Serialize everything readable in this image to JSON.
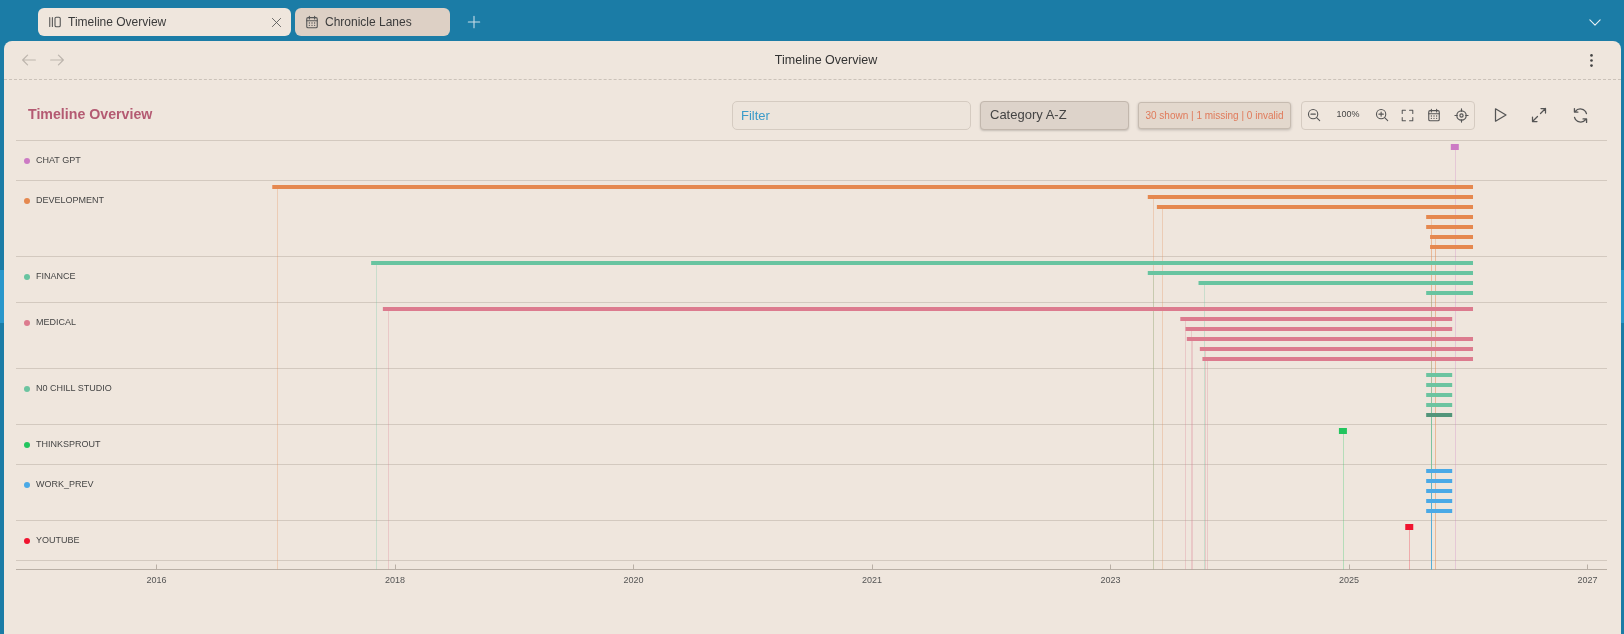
{
  "tabs": [
    {
      "label": "Timeline Overview",
      "kind": "overview",
      "selected": true
    },
    {
      "label": "Chronicle Lanes",
      "kind": "lanes",
      "selected": false
    }
  ],
  "nav": {
    "title": "Timeline Overview",
    "back": {
      "disabled": true
    },
    "forward": {
      "disabled": true
    }
  },
  "toolbar": {
    "title": "Timeline Overview",
    "filter": {
      "placeholder": "Filter"
    },
    "sort": {
      "value": "Category A-Z"
    },
    "summary": "30 shown | 1 missing | 0 invalid",
    "zoom_level": "100%"
  },
  "timeline": {
    "lanes": [
      {
        "name": "CHAT GPT",
        "color": "#cc7ac4",
        "bars": [
          {
            "kind": "point",
            "selected": false
          }
        ]
      },
      {
        "name": "DEVELOPMENT",
        "color": "#e5884f",
        "bars": [
          {
            "kind": "range",
            "selected": false
          },
          {
            "kind": "range",
            "selected": false
          },
          {
            "kind": "range",
            "selected": false
          },
          {
            "kind": "range",
            "selected": false
          },
          {
            "kind": "range",
            "selected": false
          },
          {
            "kind": "range",
            "selected": false
          },
          {
            "kind": "range",
            "selected": false
          }
        ]
      },
      {
        "name": "FINANCE",
        "color": "#68c4a0",
        "bars": [
          {
            "kind": "range",
            "selected": false
          },
          {
            "kind": "range",
            "selected": false
          },
          {
            "kind": "range",
            "selected": false
          },
          {
            "kind": "range",
            "selected": false
          }
        ]
      },
      {
        "name": "MEDICAL",
        "color": "#dc7b8e",
        "bars": [
          {
            "kind": "range",
            "selected": false
          },
          {
            "kind": "range",
            "selected": false
          },
          {
            "kind": "range",
            "selected": false
          },
          {
            "kind": "range",
            "selected": false
          },
          {
            "kind": "range",
            "selected": false
          },
          {
            "kind": "range",
            "selected": false
          }
        ]
      },
      {
        "name": "N0 CHILL STUDIO",
        "color": "#6cc4a0",
        "bars": [
          {
            "kind": "range",
            "selected": false
          },
          {
            "kind": "range",
            "selected": false
          },
          {
            "kind": "range",
            "selected": false
          },
          {
            "kind": "range",
            "selected": false
          },
          {
            "kind": "range",
            "selected": true
          }
        ]
      },
      {
        "name": "THINKSPROUT",
        "color": "#22c55e",
        "bars": [
          {
            "kind": "point",
            "selected": false
          }
        ]
      },
      {
        "name": "WORK_PREV",
        "color": "#4aa9e6",
        "bars": [
          {
            "kind": "range",
            "selected": false
          },
          {
            "kind": "range",
            "selected": false
          },
          {
            "kind": "range",
            "selected": false
          },
          {
            "kind": "range",
            "selected": false
          },
          {
            "kind": "range",
            "selected": false
          }
        ]
      },
      {
        "name": "YOUTUBE",
        "color": "#f0142f",
        "bars": [
          {
            "kind": "point",
            "selected": false
          }
        ]
      }
    ],
    "axis_labels": [
      "2016",
      "2018",
      "2020",
      "2021",
      "2023",
      "2025",
      "2027"
    ]
  }
}
